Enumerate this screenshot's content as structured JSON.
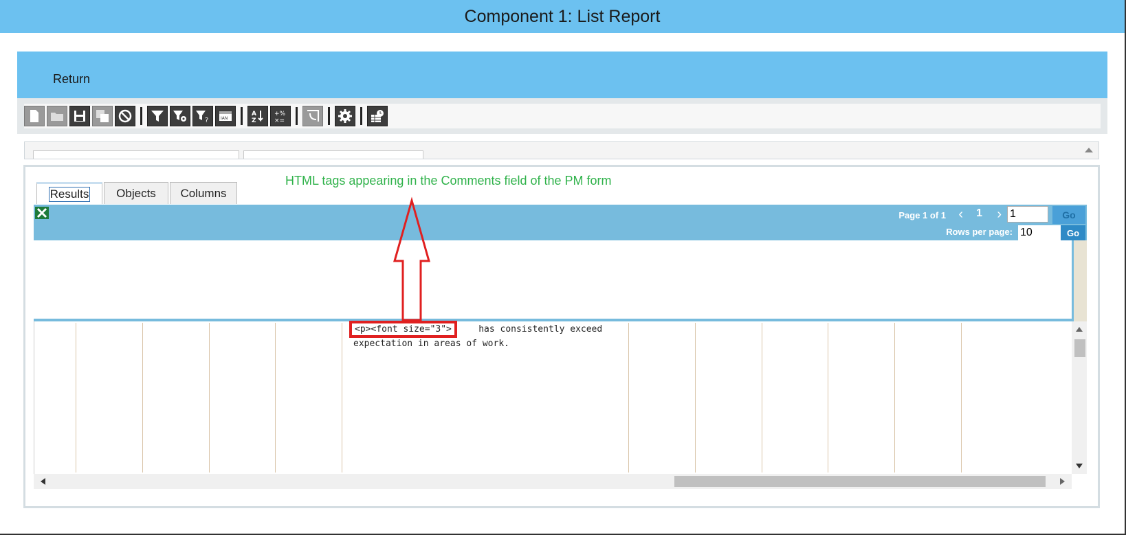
{
  "header": {
    "title": "Component 1: List Report"
  },
  "nav": {
    "return_label": "Return"
  },
  "toolbar": {
    "icons": [
      "new-document-icon",
      "open-folder-icon",
      "save-icon",
      "save-as-icon",
      "cancel-icon",
      "filter-icon",
      "filter-settings-icon",
      "filter-help-icon",
      "date-range-icon",
      "sort-az-icon",
      "calculate-icon",
      "pivot-icon",
      "settings-icon",
      "schedule-report-icon"
    ]
  },
  "tabs": [
    {
      "label": "Results",
      "active": true
    },
    {
      "label": "Objects",
      "active": false
    },
    {
      "label": "Columns",
      "active": false
    }
  ],
  "annotation": {
    "text": "HTML tags appearing in the Comments field of the PM form",
    "color": "#2fb24a"
  },
  "pager": {
    "page_text": "Page 1 of 1",
    "current_page": "1",
    "page_input": "1",
    "go_label": "Go",
    "rows_per_page_label": "Rows per page:",
    "rows_per_page_value": "10",
    "go2_label": "Go"
  },
  "table": {
    "cell": {
      "tag_text": "<p><font size=\"3\">",
      "text_rest": "    has consistently exceed",
      "text_line2": "expectation in areas of work."
    }
  },
  "colors": {
    "header_blue": "#6cc1f0",
    "grid_header_blue": "#77bbdd",
    "highlight_red": "#e02020"
  }
}
